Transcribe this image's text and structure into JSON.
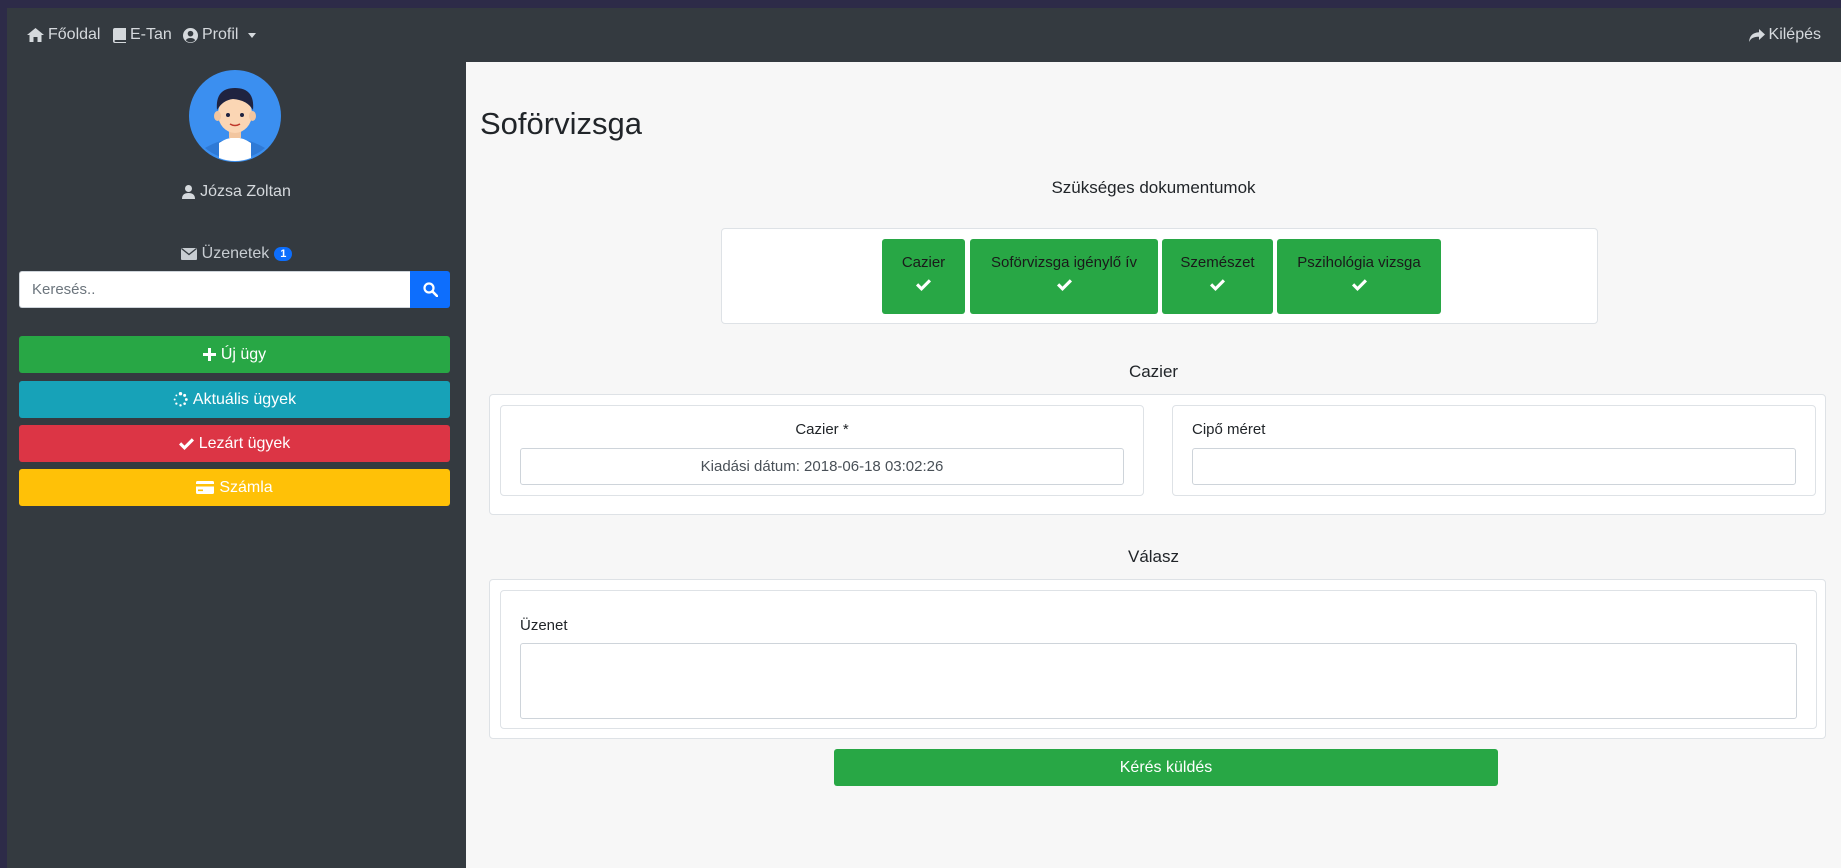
{
  "nav": {
    "home": "Főoldal",
    "etan": "E-Tan",
    "profile": "Profil",
    "logout": "Kilépés"
  },
  "sidebar": {
    "username": "Józsa Zoltan",
    "messages_label": "Üzenetek",
    "messages_count": "1",
    "search_placeholder": "Keresés..",
    "buttons": [
      {
        "label": "Új ügy",
        "color": "#28a745"
      },
      {
        "label": "Aktuális ügyek",
        "color": "#17a2b8"
      },
      {
        "label": "Lezárt ügyek",
        "color": "#dc3545"
      },
      {
        "label": "Számla",
        "color": "#ffc107"
      }
    ]
  },
  "main": {
    "title": "Soförvizsga",
    "docs_title": "Szükséges dokumentumok",
    "docs": [
      {
        "label": "Cazier",
        "status": "check-icon"
      },
      {
        "label": "Soförvizsga igénylő ív",
        "status": "check-icon"
      },
      {
        "label": "Szemészet",
        "status": "check-icon"
      },
      {
        "label": "Pszihológia vizsga",
        "status": "check-icon"
      }
    ],
    "cazier_section_title": "Cazier",
    "cazier_label": "Cazier *",
    "cazier_value": "Kiadási dátum: 2018-06-18 03:02:26",
    "shoe_size_label": "Cipő méret",
    "shoe_size_value": "",
    "reply_section_title": "Válasz",
    "message_label": "Üzenet",
    "message_value": "",
    "submit_label": "Kérés küldés"
  }
}
